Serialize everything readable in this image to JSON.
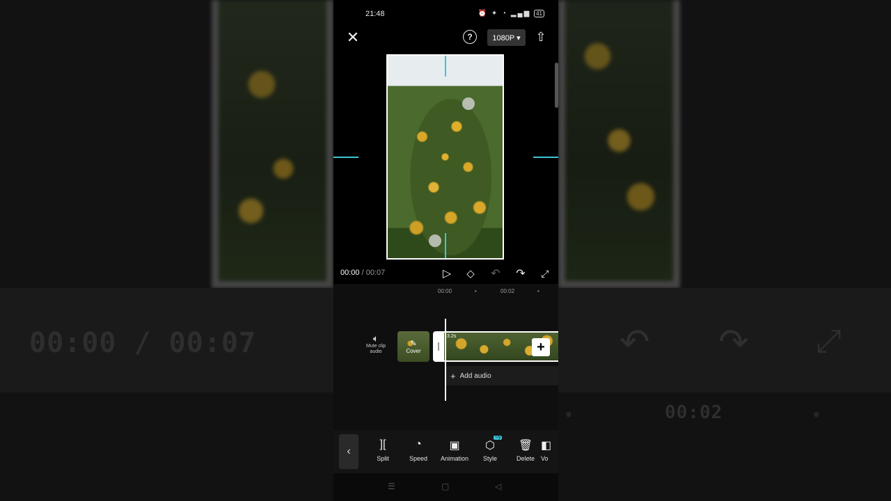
{
  "background": {
    "big_timecode": "00:00 / 00:07",
    "big_time_marker": "00:02"
  },
  "status_bar": {
    "time": "21:48",
    "icons": "⏰ ✦ ◔ ▂▄▆",
    "battery": "41"
  },
  "top_bar": {
    "close_icon": "close-icon",
    "help_symbol": "?",
    "resolution_label": "1080P ▾",
    "upload_icon": "upload-icon"
  },
  "playback": {
    "current_time": "00:00",
    "separator": " / ",
    "total_time": "00:07"
  },
  "timeline": {
    "ruler_marks": [
      "00:00",
      "•",
      "00:02",
      "•"
    ],
    "mute_label": "Mute clip audio",
    "cover_label": "Cover",
    "clip_duration": "3.2s",
    "add_audio_label": "Add audio"
  },
  "toolbar": {
    "tools": [
      {
        "label": "Split",
        "icon": "split-icon"
      },
      {
        "label": "Speed",
        "icon": "speed-icon"
      },
      {
        "label": "Animation",
        "icon": "animation-icon"
      },
      {
        "label": "Style",
        "icon": "style-icon",
        "badge": "Try"
      },
      {
        "label": "Delete",
        "icon": "delete-icon"
      },
      {
        "label": "Vo",
        "icon": "volume-icon"
      }
    ]
  },
  "colors": {
    "accent": "#3ec6d6",
    "background": "#000000",
    "panel": "#141414"
  }
}
